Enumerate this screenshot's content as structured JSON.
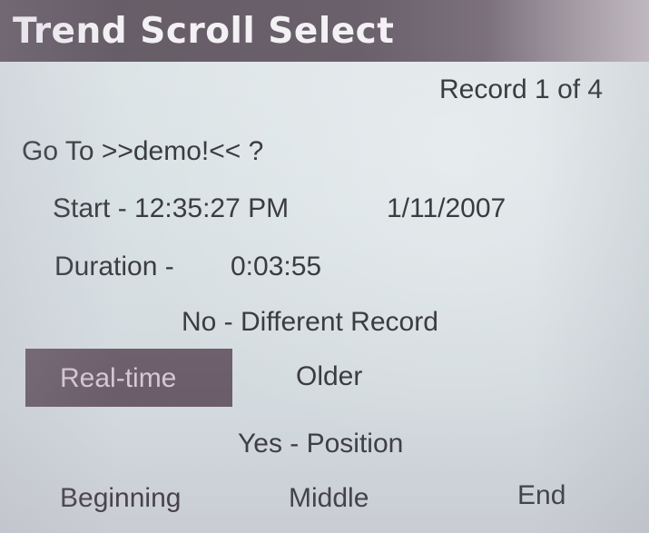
{
  "header": {
    "title": "Trend Scroll Select"
  },
  "record": {
    "indicator": "Record 1 of 4"
  },
  "goto": {
    "prompt": "Go To >>demo!<< ?"
  },
  "details": {
    "start_label_time": "Start - 12:35:27 PM",
    "start_date": "1/11/2007",
    "duration_label": "Duration -",
    "duration_value": "0:03:55"
  },
  "no_option": {
    "label": "No - Different Record",
    "buttons": {
      "realtime": "Real-time",
      "older": "Older"
    },
    "selected": "Real-time"
  },
  "yes_option": {
    "label": "Yes - Position",
    "buttons": {
      "beginning": "Beginning",
      "middle": "Middle",
      "end": "End"
    }
  },
  "colors": {
    "title_bar": "#655c66",
    "title_text": "#f3f1f4",
    "screen_bg": "#d9e0e3",
    "selected_button_bg": "#6a5d69",
    "selected_button_text": "#d8c8d4",
    "text": "#3a3c40"
  }
}
